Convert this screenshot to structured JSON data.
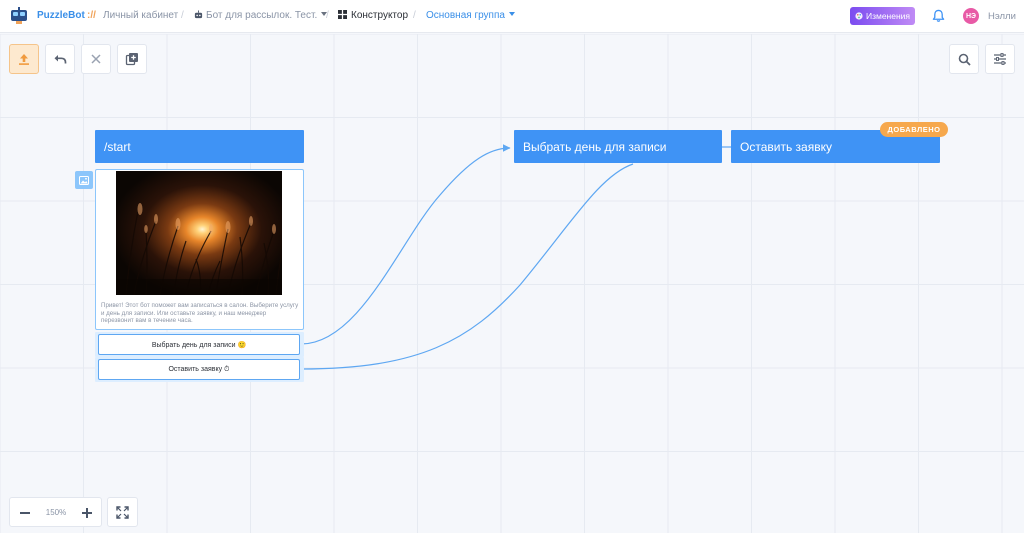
{
  "header": {
    "brand": "PuzzleBot",
    "brand_slashes": "://",
    "crumb_cabinet": "Личный кабинет",
    "crumb_bot": "Бот для рассылок. Тест.",
    "crumb_constructor": "Конструктор",
    "crumb_group": "Основная группа",
    "changes_label": "Изменения",
    "avatar_initials": "НЭ",
    "user_name": "Нэлли"
  },
  "canvas": {
    "start_node": "/start",
    "message_text": "Привет! Этот бот поможет вам записаться в салон. Выберите услугу и день для записи. Или оставьте заявку, и наш менеджер перезвонит вам в течение часа.",
    "buttons": [
      "Выбрать день для записи 🙂",
      "Оставить заявку ⏱"
    ],
    "node_choose_day": "Выбрать день для записи",
    "node_leave_request": "Оставить заявку",
    "badge_added": "ДОБАВЛЕНО"
  },
  "zoom": {
    "level": "150%"
  },
  "colors": {
    "accent": "#3f93f5",
    "badge": "#f6a84d",
    "avatar": "#e85aa6",
    "changes_gradient_start": "#7b4cf0",
    "changes_gradient_end": "#c08bf5"
  }
}
